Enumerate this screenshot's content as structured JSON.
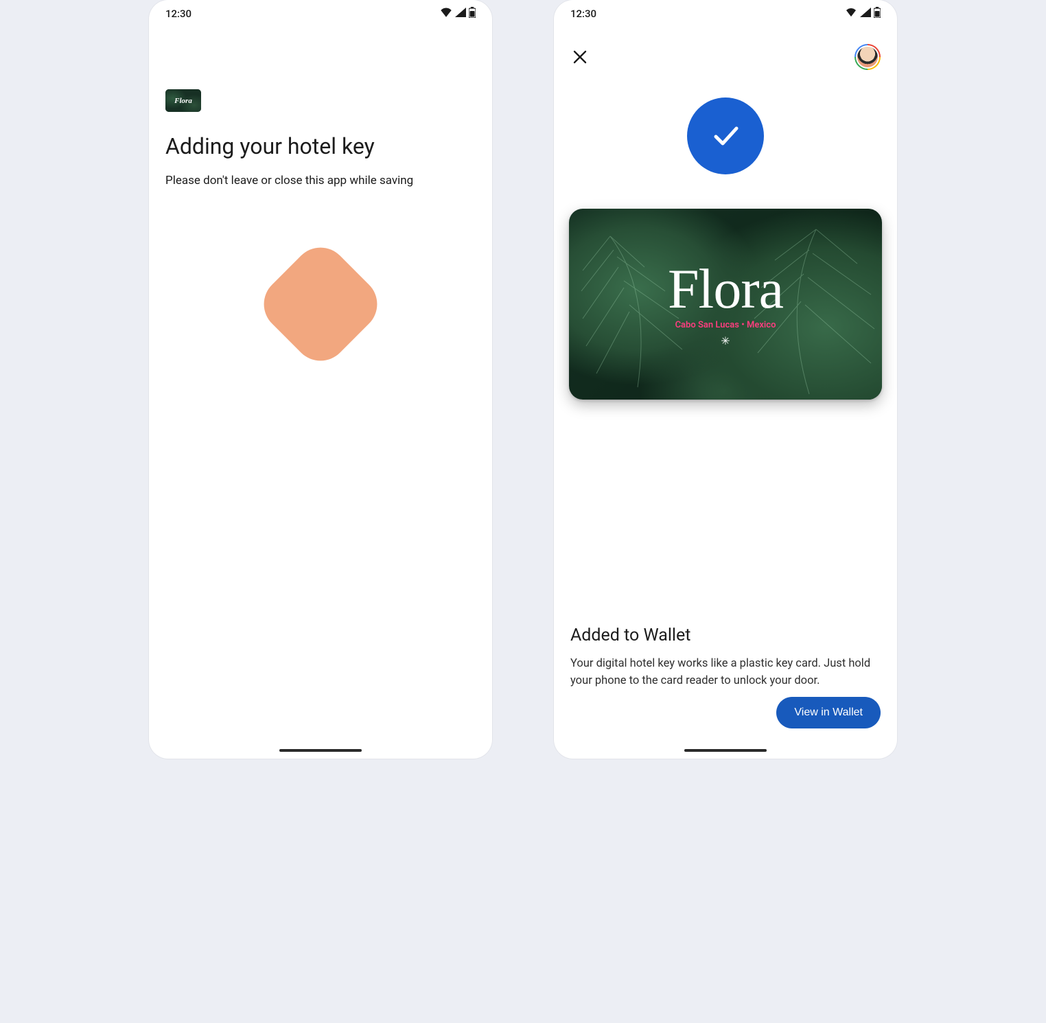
{
  "status": {
    "time": "12:30"
  },
  "screen1": {
    "card_brand": "Flora",
    "title": "Adding your hotel key",
    "subtitle": "Please don't leave or close this app while saving"
  },
  "screen2": {
    "card": {
      "brand": "Flora",
      "location": "Cabo San Lucas  •  Mexico"
    },
    "result_title": "Added to Wallet",
    "result_desc": "Your digital hotel key works like a plastic key card. Just hold your phone to the card reader to unlock your door.",
    "cta_label": "View in Wallet"
  }
}
